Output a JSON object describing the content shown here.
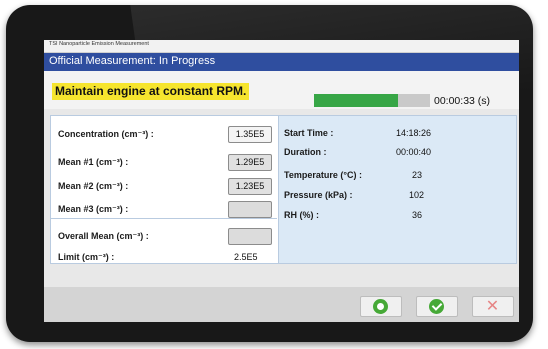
{
  "window": {
    "title": "TSI Nanoparticle Emission Measurement"
  },
  "header": {
    "title": "Official Measurement: In Progress"
  },
  "instruction": "Maintain engine at constant RPM.",
  "progress": {
    "fraction": 0.72,
    "time": "00:00:33 (s)"
  },
  "left_panel": {
    "concentration_label": "Concentration (cm⁻³) :",
    "concentration_value": "1.35E5",
    "mean1_label": "Mean #1 (cm⁻³) :",
    "mean1_value": "1.29E5",
    "mean2_label": "Mean #2 (cm⁻³) :",
    "mean2_value": "1.23E5",
    "mean3_label": "Mean #3 (cm⁻³) :",
    "mean3_value": "",
    "overall_label": "Overall Mean (cm⁻³) :",
    "overall_value": "",
    "limit_label": "Limit (cm⁻³) :",
    "limit_value": "2.5E5"
  },
  "right_panel": {
    "start_label": "Start Time :",
    "start_value": "14:18:26",
    "duration_label": "Duration :",
    "duration_value": "00:00:40",
    "temp_label": "Temperature (°C) :",
    "temp_value": "23",
    "pressure_label": "Pressure (kPa) :",
    "pressure_value": "102",
    "rh_label": "RH (%) :",
    "rh_value": "36"
  },
  "footer": {
    "buttons": [
      "back-icon",
      "check-icon",
      "close-icon"
    ]
  },
  "colors": {
    "header": "#2f4e9f",
    "instruction_highlight": "#f6e52e",
    "progress": "#37a646",
    "right_panel": "#dbe9f6",
    "action_green": "#46a937",
    "cancel_red": "#e68585"
  }
}
